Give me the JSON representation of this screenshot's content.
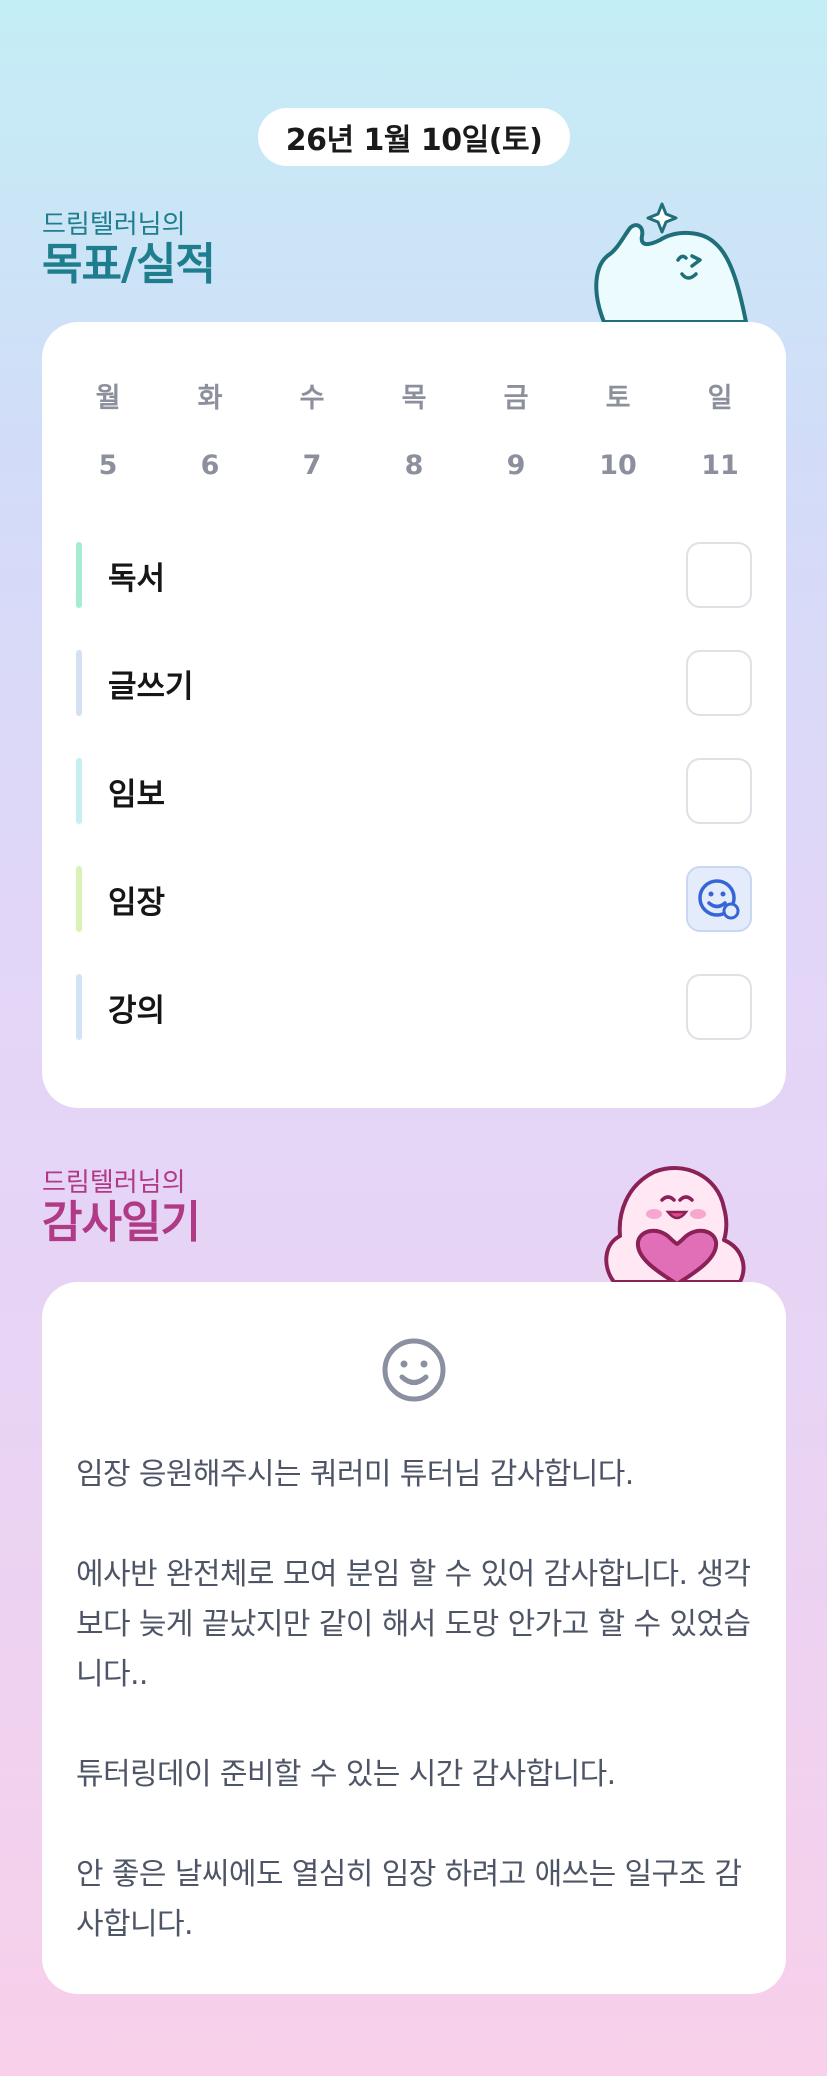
{
  "header": {
    "date": "26년 1월 10일(토)"
  },
  "goals": {
    "owner": "드림텔러님의",
    "title": "목표/실적",
    "weekdays": [
      "월",
      "화",
      "수",
      "목",
      "금",
      "토",
      "일"
    ],
    "daynums": [
      "5",
      "6",
      "7",
      "8",
      "9",
      "10",
      "11"
    ],
    "items": [
      {
        "label": "독서",
        "color": "#a6ecd0",
        "checked": false
      },
      {
        "label": "글쓰기",
        "color": "#d5e1f2",
        "checked": false
      },
      {
        "label": "임보",
        "color": "#c4f0f2",
        "checked": false
      },
      {
        "label": "임장",
        "color": "#d8f2b8",
        "checked": true
      },
      {
        "label": "강의",
        "color": "#d3e3f6",
        "checked": false
      }
    ]
  },
  "thanks": {
    "owner": "드림텔러님의",
    "title": "감사일기",
    "entries": [
      "임장 응원해주시는 쿼러미 튜터님 감사합니다.",
      "에사반 완전체로 모여 분임 할 수 있어 감사합니다. 생각보다 늦게 끝났지만 같이 해서 도망 안가고 할 수 있었습니다..",
      "튜터링데이 준비할 수 있는 시간 감사합니다.",
      "안 좋은 날씨에도 열심히 임장 하려고 애쓰는 일구조 감사합니다."
    ]
  },
  "colors": {
    "goals_title": "#1f7e8e",
    "thanks_title": "#b03a85",
    "check_done_bg": "#e4ecfb",
    "check_icon": "#3566d6"
  },
  "icons": {
    "done_check": "smile-sticker-icon",
    "thanks_mood": "smile-face-icon"
  }
}
